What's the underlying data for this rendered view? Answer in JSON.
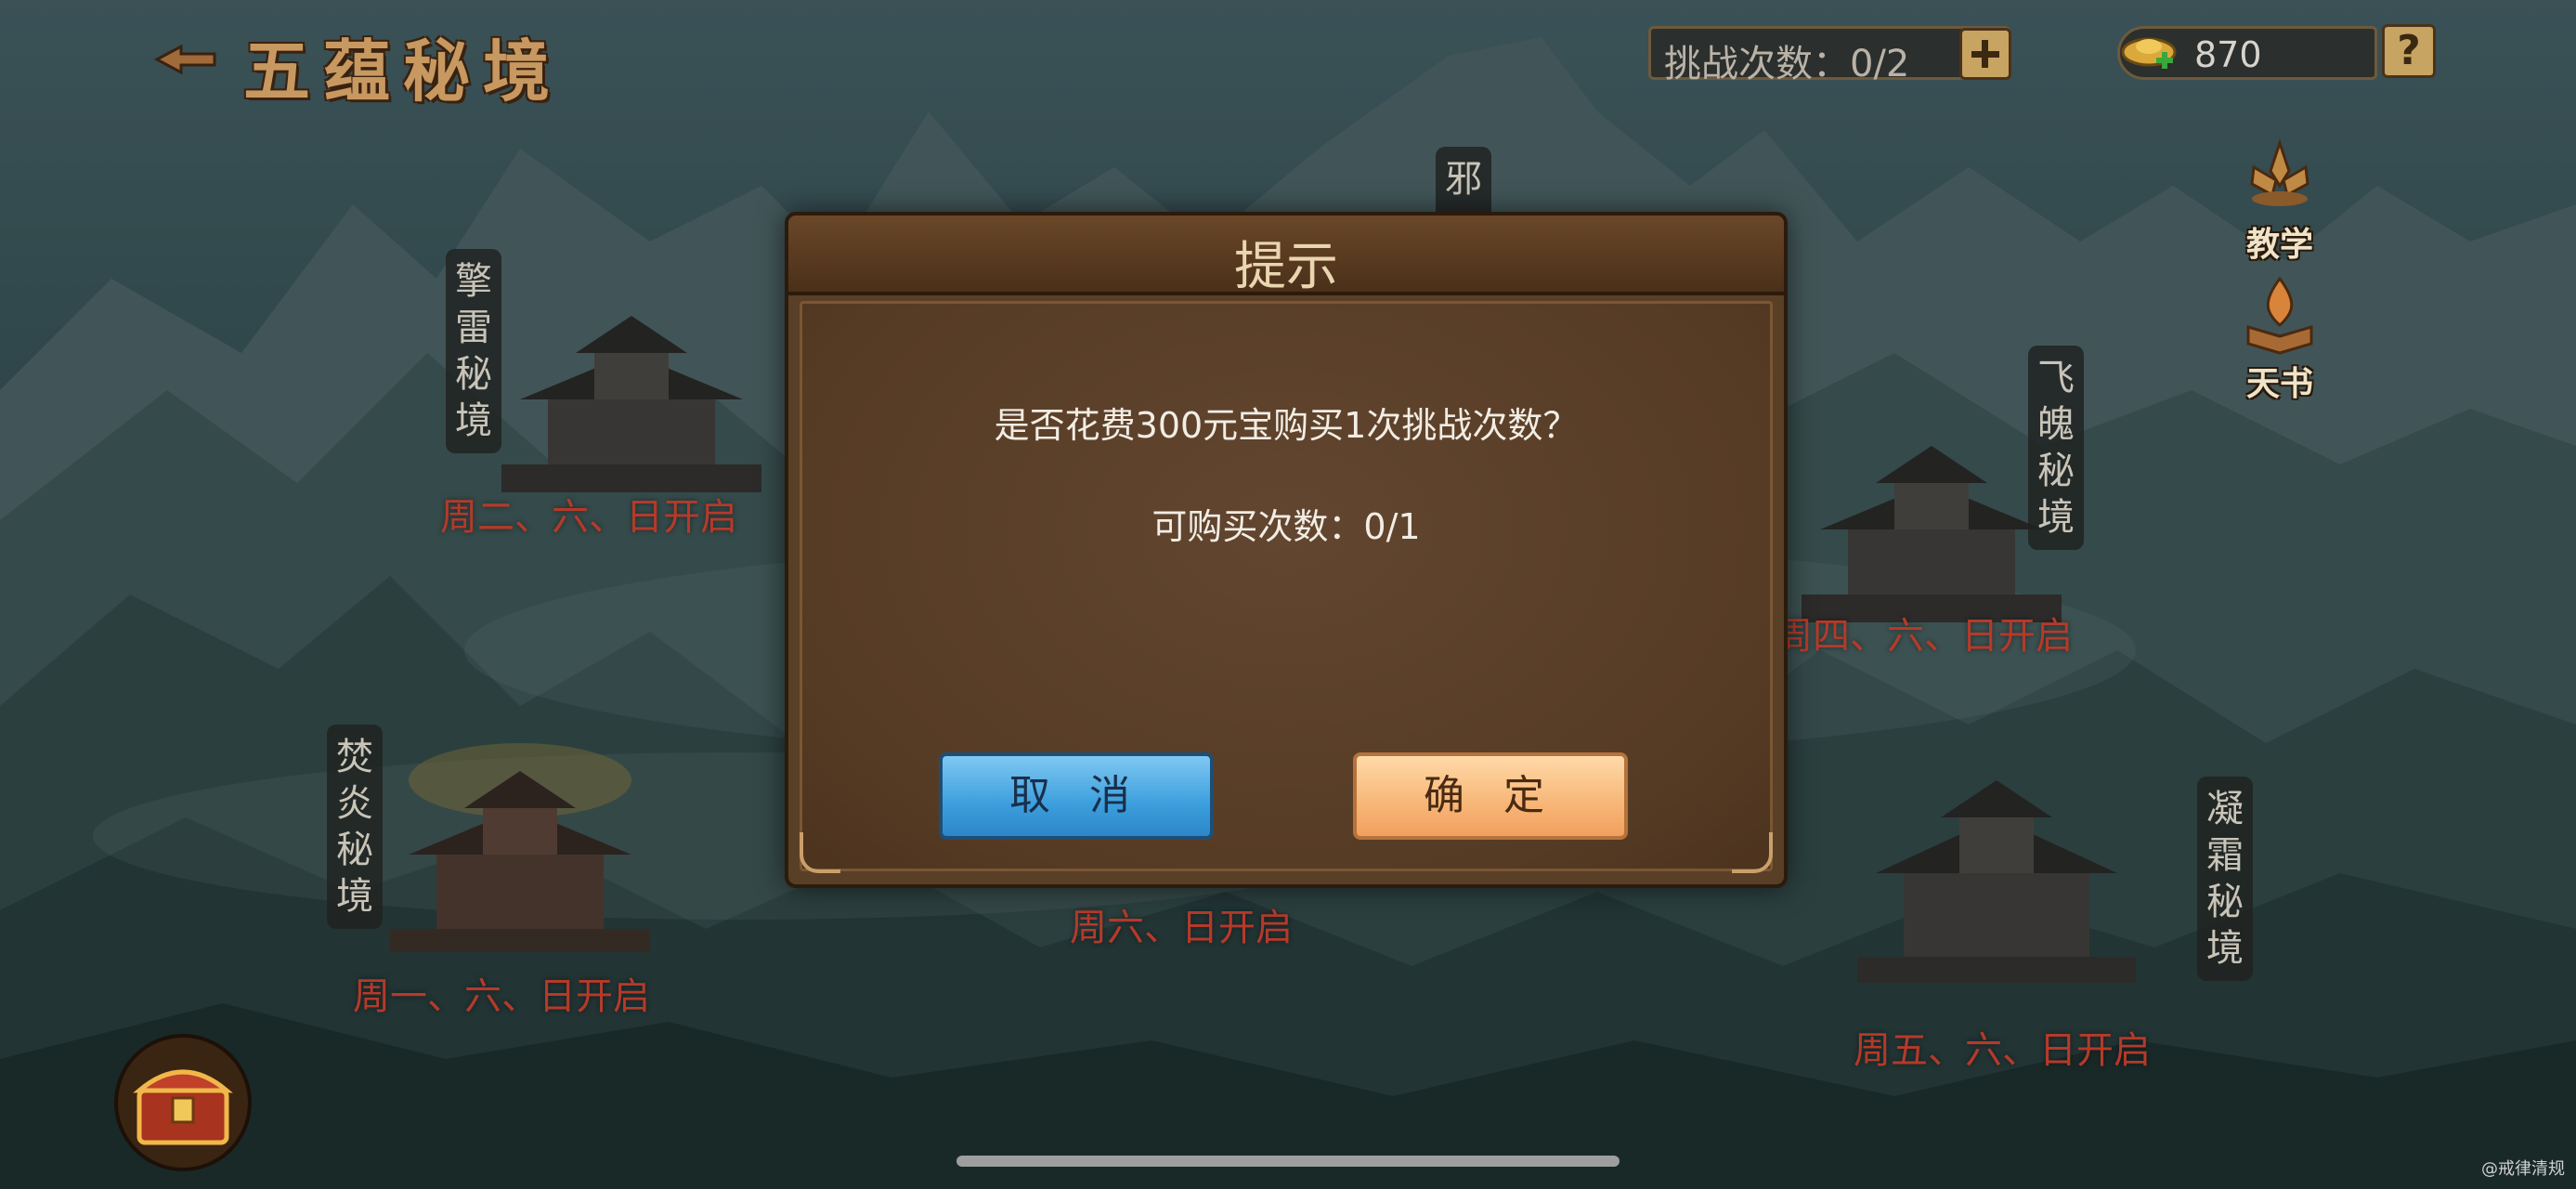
{
  "header": {
    "title": "五蕴秘境",
    "challenge_counter": "挑战次数：0/2",
    "currency_value": "870",
    "help_label": "?"
  },
  "side_buttons": {
    "teach_label": "教学",
    "book_label": "天书"
  },
  "realms": [
    {
      "name": "擎雷秘境",
      "schedule": "周二、六、日开启"
    },
    {
      "name": "飞魄秘境",
      "schedule": "周四、六、日开启"
    },
    {
      "name": "焚炎秘境",
      "schedule": "周一、六、日开启"
    },
    {
      "name": "凝霜秘境",
      "schedule": "周五、六、日开启"
    },
    {
      "name": "邪",
      "schedule": "周六、日开启"
    }
  ],
  "dialog": {
    "title": "提示",
    "message": "是否花费300元宝购买1次挑战次数？",
    "purchasable": "可购买次数：0/1",
    "cancel_label": "取 消",
    "confirm_label": "确 定"
  },
  "watermark": "@戒律清规",
  "icons": {
    "back": "back-arrow-icon",
    "currency": "gold-ingot-icon",
    "add": "plus-icon",
    "teach": "lotus-icon",
    "book": "flame-book-icon",
    "chest": "treasure-chest-icon"
  },
  "colors": {
    "dialog_bg": "#5a3f27",
    "cancel_btn": "#3c9fdd",
    "confirm_btn": "#f7b677",
    "schedule_text": "#b43a2a",
    "title_text": "#c79860"
  }
}
